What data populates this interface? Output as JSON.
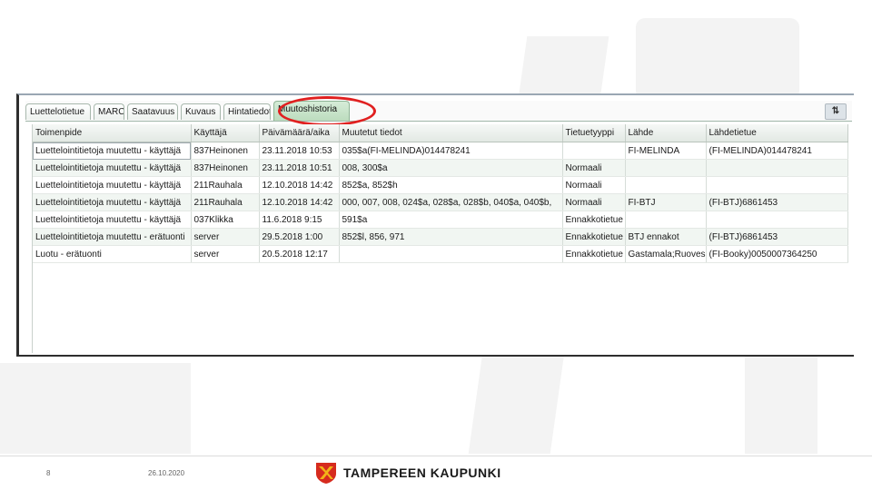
{
  "window": {
    "tabs": [
      "Luettelotietue",
      "MARC",
      "Saatavuus",
      "Kuvaus",
      "Hintatiedot",
      "Muutoshistoria"
    ],
    "active_tab": "Muutoshistoria",
    "tool_button": "⇅",
    "columns": [
      "Toimenpide",
      "Käyttäjä",
      "Päivämäärä/aika",
      "Muutetut tiedot",
      "Tietuetyyppi",
      "Lähde",
      "Lähdetietue"
    ],
    "rows": [
      [
        "Luettelointitietoja muutettu - käyttäjä",
        "837Heinonen",
        "23.11.2018 10:53",
        "035$a(FI-MELINDA)014478241",
        "",
        "FI-MELINDA",
        "(FI-MELINDA)014478241"
      ],
      [
        "Luettelointitietoja muutettu - käyttäjä",
        "837Heinonen",
        "23.11.2018 10:51",
        "008, 300$a",
        "Normaali",
        "",
        ""
      ],
      [
        "Luettelointitietoja muutettu - käyttäjä",
        "211Rauhala",
        "12.10.2018 14:42",
        "852$a, 852$h",
        "Normaali",
        "",
        ""
      ],
      [
        "Luettelointitietoja muutettu - käyttäjä",
        "211Rauhala",
        "12.10.2018 14:42",
        "000, 007, 008, 024$a, 028$a, 028$b, 040$a, 040$b,",
        "Normaali",
        "FI-BTJ",
        "(FI-BTJ)6861453"
      ],
      [
        "Luettelointitietoja muutettu - käyttäjä",
        "037Klikka",
        "11.6.2018 9:15",
        "591$a",
        "Ennakkotietue",
        "",
        ""
      ],
      [
        "Luettelointitietoja muutettu - erätuonti",
        "server",
        "29.5.2018 1:00",
        "852$l, 856, 971",
        "Ennakkotietue",
        "BTJ ennakot",
        "(FI-BTJ)6861453"
      ],
      [
        "Luotu - erätuonti",
        "server",
        "20.5.2018 12:17",
        "",
        "Ennakkotietue",
        "Gastamala;Ruoves",
        "(FI-Booky)0050007364250"
      ]
    ]
  },
  "footer": {
    "page_number": "8",
    "date": "26.10.2020",
    "org_name": "TAMPEREEN KAUPUNKI"
  },
  "colors": {
    "highlight": "#e02020",
    "active_tab": "#bcdcbe",
    "logo_red": "#d62b1e",
    "logo_yellow": "#f2b418"
  }
}
